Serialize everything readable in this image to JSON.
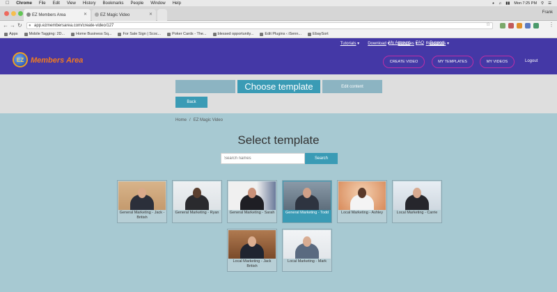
{
  "menubar": {
    "apple": "",
    "items": [
      "Chrome",
      "File",
      "Edit",
      "View",
      "History",
      "Bookmarks",
      "People",
      "Window",
      "Help"
    ],
    "clock": "Mon 7:25 PM"
  },
  "browser": {
    "tabs": [
      {
        "label": "EZ Members Area"
      },
      {
        "label": "EZ Magic Video"
      }
    ],
    "profile": "Frank",
    "url": "app.ezmembersarea.com/create-video/127",
    "bookmarks": [
      "Apps",
      "Mobile Tagging: 2D...",
      "Home Business Sq...",
      "For Sale Sign | Scoc...",
      "Poker Cards - The...",
      "blessed opportunity...",
      "Edit Plugins ‹ iSenn...",
      "EbaySort"
    ]
  },
  "site": {
    "logo_badge": "EZ",
    "logo_text": "Members Area",
    "topnav": [
      "Tutorials",
      "Download",
      "Bonuses",
      "Resources"
    ],
    "topnav_right": [
      "My Account",
      "FAQ",
      "Support"
    ],
    "buttons": {
      "create_video": "CREATE VIDEO",
      "my_templates": "MY TEMPLATES",
      "my_videos": "MY VIDEOS",
      "logout": "Logout"
    }
  },
  "steps": {
    "step1": "",
    "step2": "Choose template",
    "step3": "Edit content",
    "back": "Back"
  },
  "breadcrumb": {
    "home": "Home",
    "current": "EZ Magic Video"
  },
  "page_title": "Select template",
  "search": {
    "placeholder": "Search names",
    "button": "Search"
  },
  "templates": [
    {
      "title": "General Marketing - Jack - British"
    },
    {
      "title": "General Marketing - Ryan"
    },
    {
      "title": "General Marketing - Sarah"
    },
    {
      "title": "General Marketing - Todd"
    },
    {
      "title": "Local Marketing - Ashley"
    },
    {
      "title": "Local Marketing - Carrie"
    },
    {
      "title": "Local Marketing - Jack British"
    },
    {
      "title": "Local Marketing - Mark"
    }
  ],
  "colors": {
    "header": "#4438a6",
    "accent": "#3a9bb5",
    "background": "#a7c9d2",
    "pill_border": "#c02ea6"
  }
}
